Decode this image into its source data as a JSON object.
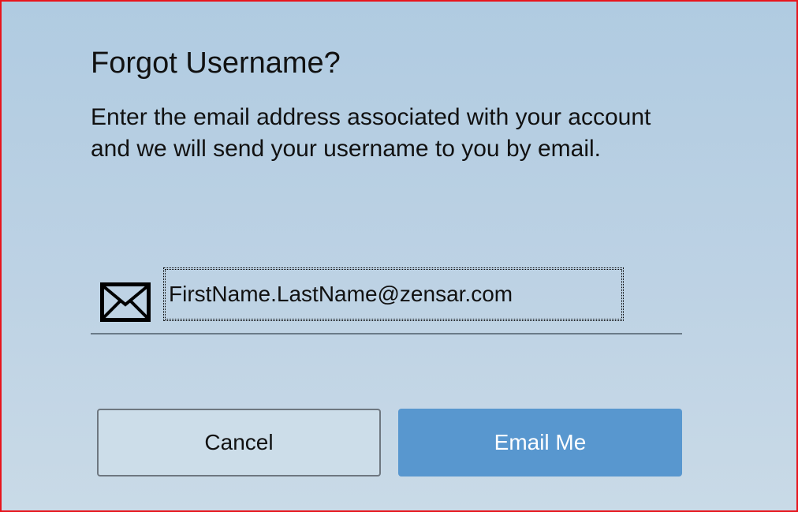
{
  "dialog": {
    "title": "Forgot Username?",
    "description": "Enter the email address associated with your account and we will send your username to you by email.",
    "email_field": {
      "value": "FirstName.LastName@zensar.com",
      "icon": "envelope-icon"
    },
    "buttons": {
      "cancel_label": "Cancel",
      "submit_label": "Email Me"
    }
  },
  "colors": {
    "background_top": "#b0cbe1",
    "background_bottom": "#c9dae7",
    "primary_button": "#5897cf",
    "frame_border": "#e8141c"
  }
}
